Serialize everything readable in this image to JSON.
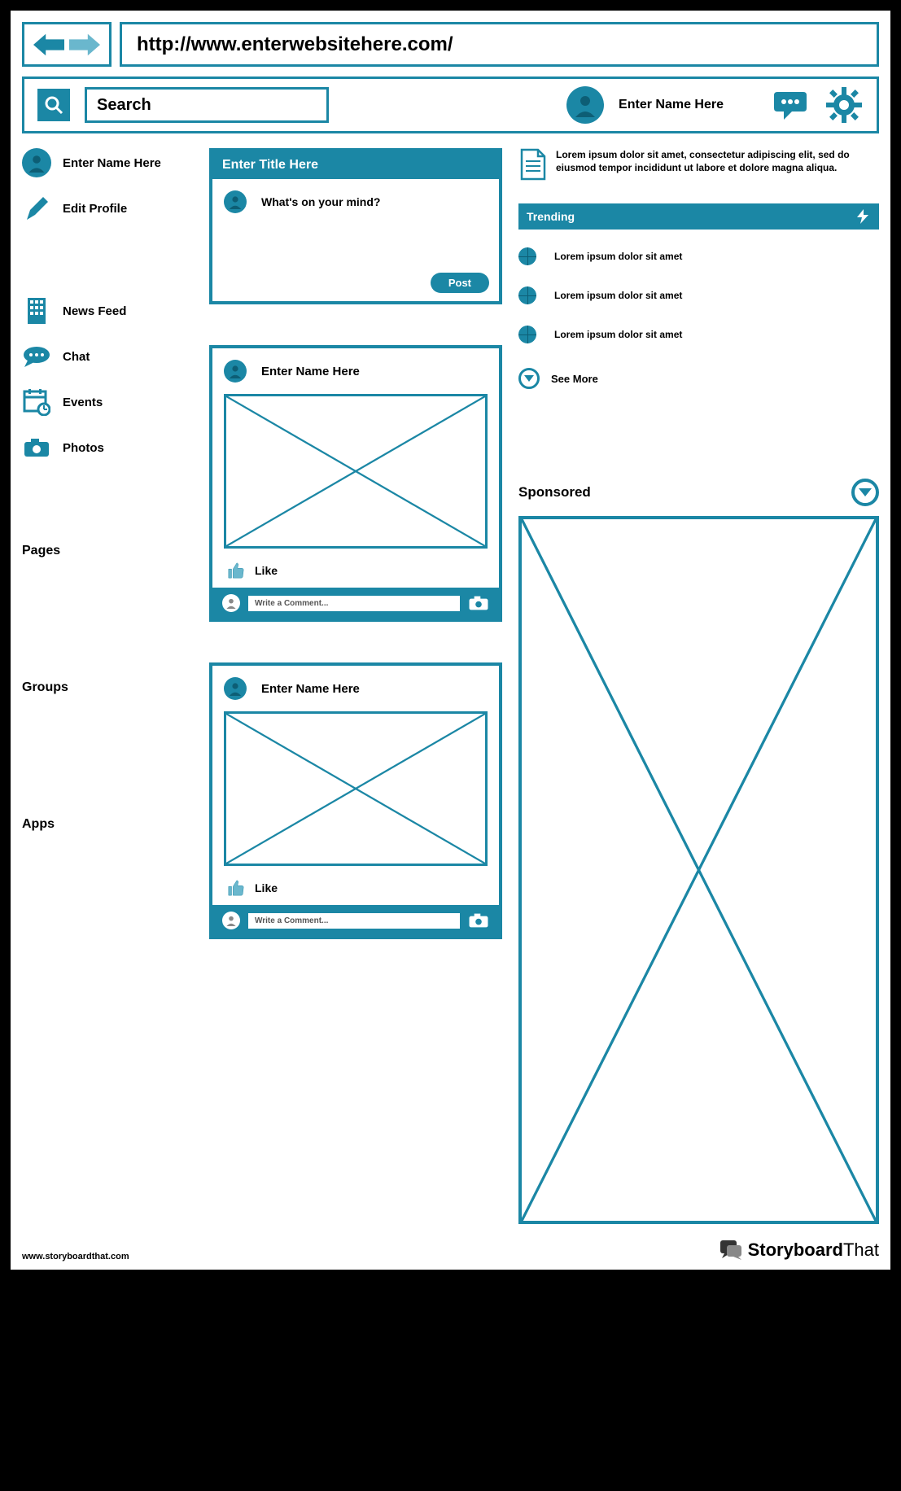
{
  "url": "http://www.enterwebsitehere.com/",
  "header": {
    "search_placeholder": "Search",
    "user_name": "Enter Name Here"
  },
  "sidebar": {
    "user_name": "Enter Name Here",
    "edit_profile": "Edit Profile",
    "items": [
      {
        "label": "News Feed"
      },
      {
        "label": "Chat"
      },
      {
        "label": "Events"
      },
      {
        "label": "Photos"
      }
    ],
    "sections": [
      "Pages",
      "Groups",
      "Apps"
    ]
  },
  "compose": {
    "title": "Enter Title Here",
    "prompt": "What's on your mind?",
    "post_label": "Post"
  },
  "posts": [
    {
      "author": "Enter Name Here",
      "like_label": "Like",
      "comment_placeholder": "Write a Comment..."
    },
    {
      "author": "Enter Name Here",
      "like_label": "Like",
      "comment_placeholder": "Write a Comment..."
    }
  ],
  "note_text": "Lorem ipsum dolor sit amet, consectetur adipiscing elit, sed do eiusmod tempor incididunt ut labore et dolore magna aliqua.",
  "trending": {
    "title": "Trending",
    "items": [
      "Lorem ipsum dolor sit amet",
      "Lorem ipsum dolor sit amet",
      "Lorem ipsum dolor sit amet"
    ],
    "see_more": "See More"
  },
  "sponsored_label": "Sponsored",
  "footer": {
    "left": "www.storyboardthat.com",
    "brand_a": "Storyboard",
    "brand_b": "That"
  }
}
